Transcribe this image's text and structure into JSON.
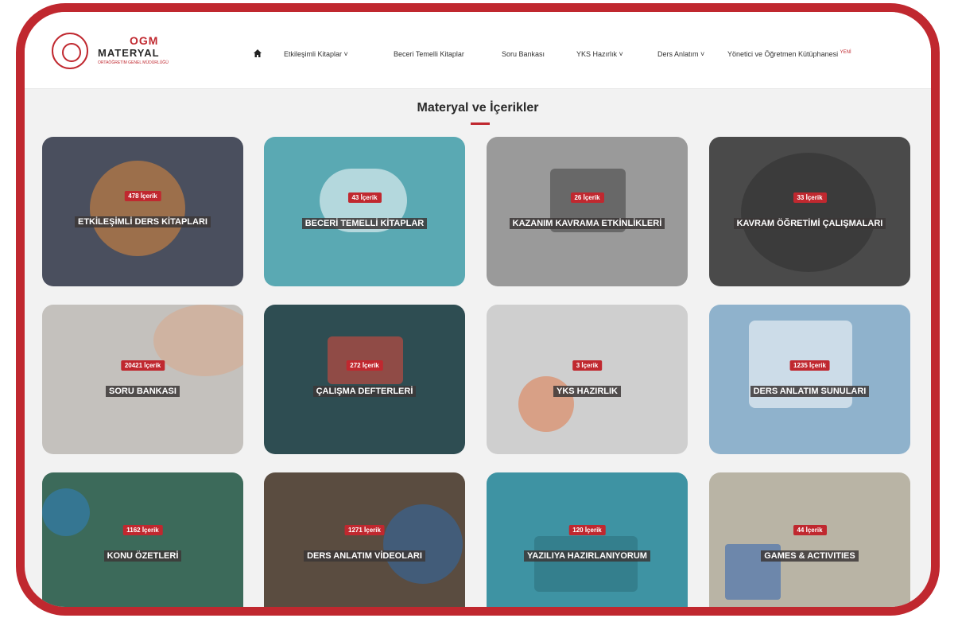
{
  "brand": {
    "line1": "OGM",
    "line2": "MATERYAL",
    "line3": "ORTAÖĞRETİM GENEL MÜDÜRLÜĞÜ"
  },
  "nav": {
    "home_icon": "home-icon",
    "items": [
      {
        "label": "Etkileşimli Kitaplar ˅"
      },
      {
        "label": "Beceri Temelli Kitaplar"
      },
      {
        "label": "Soru Bankası"
      },
      {
        "label": "YKS Hazırlık ˅"
      },
      {
        "label": "Ders Anlatım ˅"
      },
      {
        "label": "Yönetici ve Öğretmen Kütüphanesi",
        "badge": "YENİ"
      }
    ]
  },
  "section": {
    "title": "Materyal ve İçerikler"
  },
  "cards": [
    {
      "count": "478 İçerik",
      "title": "ETKİLEŞİMLİ DERS KİTAPLARI",
      "color": "#4a4f5e"
    },
    {
      "count": "43 İçerik",
      "title": "BECERİ TEMELLİ KİTAPLAR",
      "color": "#5aa9b3"
    },
    {
      "count": "26 İçerik",
      "title": "KAZANIM KAVRAMA ETKİNLİKLERİ",
      "color": "#9a9a9a"
    },
    {
      "count": "33 İçerik",
      "title": "KAVRAM ÖĞRETİMİ ÇALIŞMALARI",
      "color": "#4a4a4a"
    },
    {
      "count": "20421 İçerik",
      "title": "SORU BANKASI",
      "color": "#c4c1bd"
    },
    {
      "count": "272 İçerik",
      "title": "ÇALIŞMA DEFTERLERİ",
      "color": "#2e4d52"
    },
    {
      "count": "3 İçerik",
      "title": "YKS HAZIRLIK",
      "color": "#cfcfcf"
    },
    {
      "count": "1235 İçerik",
      "title": "DERS ANLATIM SUNULARI",
      "color": "#8fb2cc"
    },
    {
      "count": "1162 İçerik",
      "title": "KONU ÖZETLERİ",
      "color": "#3c6a5a"
    },
    {
      "count": "1271 İçerik",
      "title": "DERS ANLATIM VİDEOLARI",
      "color": "#5a4c40"
    },
    {
      "count": "120 İçerik",
      "title": "YAZILIYA HAZIRLANIYORUM",
      "color": "#3e93a3"
    },
    {
      "count": "44 İçerik",
      "title": "GAMES & ACTIVITIES",
      "color": "#b9b4a5"
    }
  ]
}
